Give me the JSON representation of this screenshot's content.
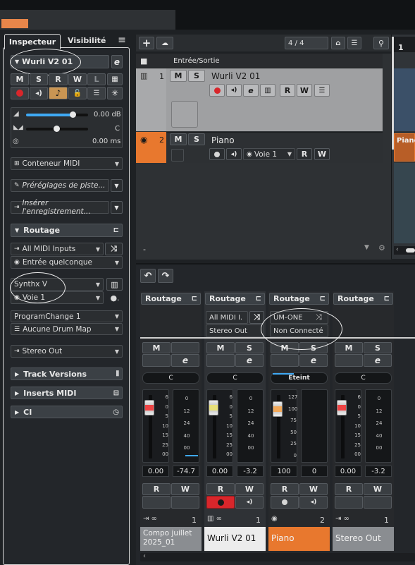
{
  "inspector": {
    "tabs": [
      "Inspecteur",
      "Visibilité"
    ],
    "menu_glyph": "≡",
    "track_name": "Wurli V2 01",
    "buttons_row1": [
      "M",
      "S",
      "R",
      "W",
      "L"
    ],
    "volume": "0.00 dB",
    "pan": "C",
    "delay": "0.00 ms",
    "midi_container": "Conteneur MIDI",
    "track_presets": "Préréglages de piste...",
    "insert_record": "Insérer l'enregistrement...",
    "routage_label": "Routage",
    "input": "All MIDI Inputs",
    "channel_input": "Entrée quelconque",
    "output_instrument": "Synthx V",
    "voice": "Voie 1",
    "program_change": "ProgramChange 1",
    "drum_map": "Aucune Drum Map",
    "audio_out": "Stereo Out",
    "sections": [
      "Track Versions",
      "Inserts MIDI",
      "CI"
    ]
  },
  "project": {
    "counter": "4 / 4",
    "folder_label": "Entrée/Sortie",
    "ruler_marker": "1",
    "tracks": [
      {
        "number": "1",
        "name": "Wurli V2 01",
        "buttons": [
          "M",
          "S"
        ],
        "voice": "",
        "rw": [
          "R",
          "W"
        ]
      },
      {
        "number": "2",
        "name": "Piano",
        "buttons": [
          "M",
          "S"
        ],
        "voice": "Voie 1",
        "rw": [
          "R",
          "W"
        ]
      }
    ],
    "right_clip_label": "Piano",
    "bottom_dash": "-"
  },
  "mixer": {
    "channels": [
      {
        "id": "compo",
        "routage": "Routage",
        "route1": "",
        "route2": "",
        "ms": [
          "M",
          ""
        ],
        "pan": "C",
        "scale": [
          "6",
          "0",
          "5",
          "10",
          "15",
          "25",
          "00"
        ],
        "meter_scale": [
          "0",
          "12",
          "24",
          "40",
          "00"
        ],
        "val_left": "0.00",
        "val_right": "-74.7",
        "rw": [
          "R",
          "W"
        ],
        "num": "1",
        "name": "Compo juillet 2025_01",
        "color": "#8a8d91"
      },
      {
        "id": "wurli",
        "routage": "Routage",
        "route1": "All MIDI I.",
        "route2": "Stereo Out",
        "ms": [
          "M",
          "S"
        ],
        "pan": "C",
        "scale": [
          "6",
          "0",
          "5",
          "10",
          "15",
          "25",
          "00"
        ],
        "meter_scale": [
          "0",
          "12",
          "24",
          "40",
          "00"
        ],
        "val_left": "0.00",
        "val_right": "-3.2",
        "rw": [
          "R",
          "W"
        ],
        "num": "1",
        "name": "Wurli V2 01",
        "color": "#ececec"
      },
      {
        "id": "piano",
        "routage": "Routage",
        "route1": "UM-ONE",
        "route2": "Non Connecté",
        "ms": [
          "M",
          "S"
        ],
        "pan": "Éteint",
        "scale": [
          "127",
          "100",
          "75",
          "50",
          "25",
          "0"
        ],
        "meter_scale": [],
        "val_left": "100",
        "val_right": "0",
        "rw": [
          "R",
          "W"
        ],
        "num": "2",
        "name": "Piano",
        "color": "#e8782e"
      },
      {
        "id": "stereo",
        "routage": "Routage",
        "route1": "",
        "route2": "",
        "ms": [
          "M",
          "S"
        ],
        "pan": "C",
        "scale": [
          "6",
          "0",
          "5",
          "10",
          "15",
          "25",
          "00"
        ],
        "meter_scale": [
          "0",
          "12",
          "24",
          "40",
          "00"
        ],
        "val_left": "0.00",
        "val_right": "-3.2",
        "rw": [
          "R",
          "W"
        ],
        "num": "1",
        "name": "Stereo Out",
        "color": "#8a8d91"
      }
    ]
  },
  "colors": {
    "accent_orange": "#e8782e",
    "record_red": "#d8262b",
    "active_orange_btn": "#d8a05a",
    "fader_blue": "#3fa9f5"
  }
}
